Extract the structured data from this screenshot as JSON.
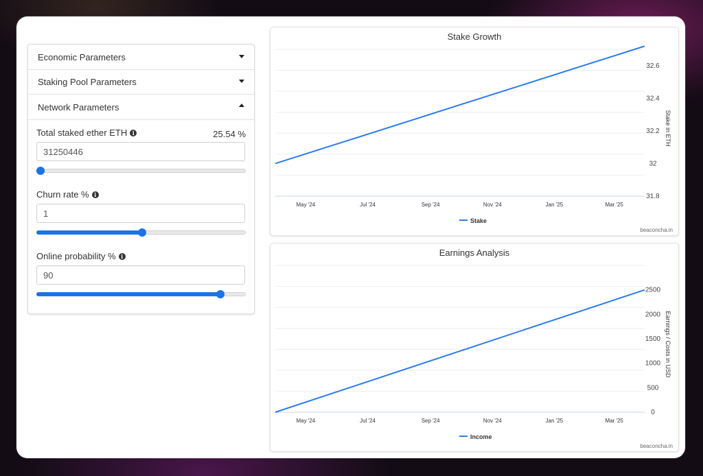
{
  "colors": {
    "accent": "#1a73e8",
    "line": "#2b7bf0"
  },
  "accordion": {
    "sections": [
      {
        "label": "Economic Parameters",
        "expanded": false
      },
      {
        "label": "Staking Pool Parameters",
        "expanded": false
      },
      {
        "label": "Network Parameters",
        "expanded": true
      }
    ],
    "fields": {
      "total_staked": {
        "label": "Total staked ether ETH",
        "percent": "25.54 %",
        "value": "31250446",
        "slider_fraction": 0.02
      },
      "churn": {
        "label": "Churn rate %",
        "value": "1",
        "slider_fraction": 0.505
      },
      "online": {
        "label": "Online probability %",
        "value": "90",
        "slider_fraction": 0.88
      }
    }
  },
  "charts": {
    "stake": {
      "title": "Stake Growth",
      "credit": "beaconcha.in"
    },
    "earnings": {
      "title": "Earnings Analysis",
      "credit": "beaconcha.in"
    }
  },
  "chart_data": [
    {
      "type": "line",
      "title": "Stake Growth",
      "xlabel": "",
      "ylabel": "Stake in ETH",
      "x_tick_labels": [
        "May '24",
        "Jul '24",
        "Sep '24",
        "Nov '24",
        "Jan '25",
        "Mar '25"
      ],
      "y_tick_labels": [
        "31.8",
        "32",
        "32.2",
        "32.4",
        "32.6"
      ],
      "ylim": [
        31.8,
        32.7
      ],
      "xlim": [
        "2024-04-01",
        "2025-03-31"
      ],
      "grid": true,
      "legend": "bottom",
      "series": [
        {
          "name": "Stake",
          "x": [
            "2024-04-01",
            "2025-03-31"
          ],
          "y": [
            32.0,
            32.72
          ]
        }
      ]
    },
    {
      "type": "line",
      "title": "Earnings Analysis",
      "xlabel": "",
      "ylabel": "Earnings / Costs in USD",
      "x_tick_labels": [
        "May '24",
        "Jul '24",
        "Sep '24",
        "Nov '24",
        "Jan '25",
        "Mar '25"
      ],
      "y_tick_labels": [
        "0",
        "500",
        "1000",
        "1500",
        "2000",
        "2500"
      ],
      "ylim": [
        0,
        3000
      ],
      "xlim": [
        "2024-04-01",
        "2025-03-31"
      ],
      "grid": true,
      "legend": "bottom",
      "series": [
        {
          "name": "Income",
          "x": [
            "2024-04-01",
            "2025-03-31"
          ],
          "y": [
            0,
            2500
          ]
        }
      ]
    }
  ]
}
